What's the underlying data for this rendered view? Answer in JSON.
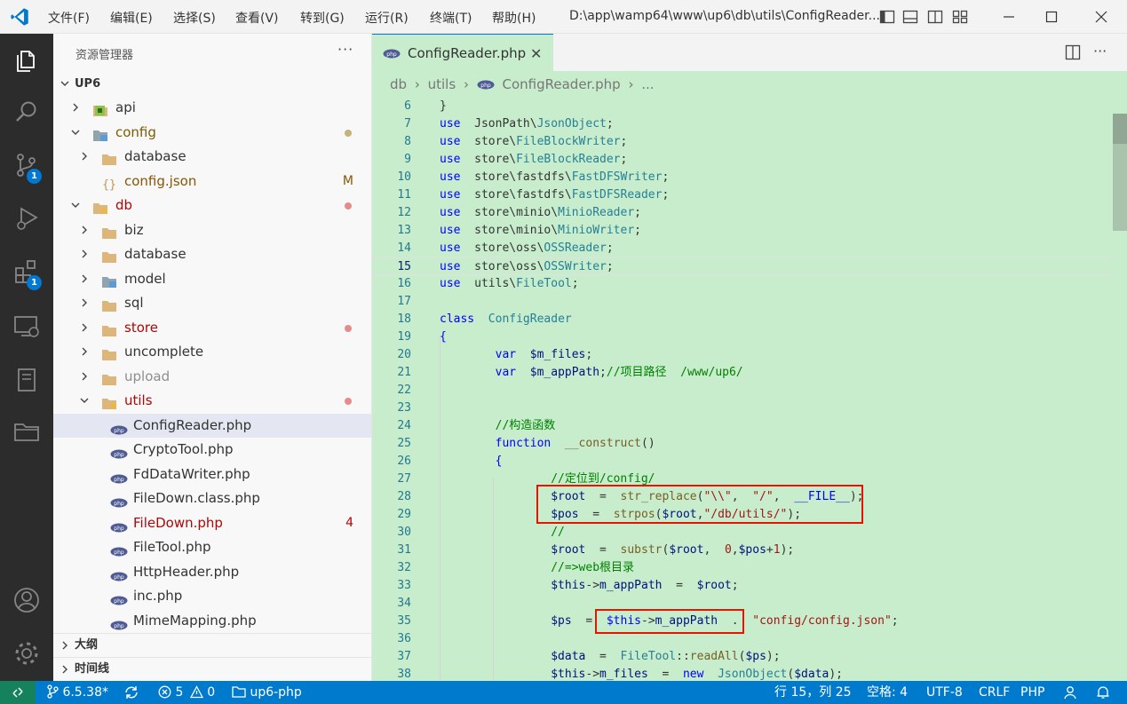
{
  "titlebar": {
    "menus": [
      "文件(F)",
      "编辑(E)",
      "选择(S)",
      "查看(V)",
      "转到(G)",
      "运行(R)",
      "终端(T)",
      "帮助(H)"
    ],
    "path": "D:\\app\\wamp64\\www\\up6\\db\\utils\\ConfigReader...."
  },
  "activitybar": {
    "source_control_badge": "1",
    "extensions_badge": "1"
  },
  "explorer": {
    "title": "资源管理器",
    "more": "···",
    "root": "UP6",
    "items": [
      {
        "label": "api",
        "depth": 1,
        "type": "folder-special",
        "expanded": false,
        "color": "#333333"
      },
      {
        "label": "config",
        "depth": 1,
        "type": "folder-config",
        "expanded": true,
        "color": "#7a5d00",
        "dot": "#c5b37a"
      },
      {
        "label": "database",
        "depth": 2,
        "type": "folder",
        "expanded": false,
        "color": "#333333"
      },
      {
        "label": "config.json",
        "depth": 2,
        "type": "json",
        "color": "#895503",
        "status": "M",
        "status_color": "#895503"
      },
      {
        "label": "db",
        "depth": 1,
        "type": "folder-db",
        "expanded": true,
        "color": "#ad0707",
        "dot": "#e48b8b"
      },
      {
        "label": "biz",
        "depth": 2,
        "type": "folder",
        "expanded": false,
        "color": "#333333"
      },
      {
        "label": "database",
        "depth": 2,
        "type": "folder",
        "expanded": false,
        "color": "#333333"
      },
      {
        "label": "model",
        "depth": 2,
        "type": "folder-model",
        "expanded": false,
        "color": "#333333"
      },
      {
        "label": "sql",
        "depth": 2,
        "type": "folder",
        "expanded": false,
        "color": "#333333"
      },
      {
        "label": "store",
        "depth": 2,
        "type": "folder",
        "expanded": false,
        "color": "#ad0707",
        "dot": "#e48b8b"
      },
      {
        "label": "uncomplete",
        "depth": 2,
        "type": "folder",
        "expanded": false,
        "color": "#333333"
      },
      {
        "label": "upload",
        "depth": 2,
        "type": "folder",
        "expanded": false,
        "color": "#8e8e90"
      },
      {
        "label": "utils",
        "depth": 2,
        "type": "folder-utils",
        "expanded": true,
        "color": "#ad0707",
        "dot": "#e48b8b"
      },
      {
        "label": "ConfigReader.php",
        "depth": 3,
        "type": "php",
        "color": "#333333",
        "selected": true
      },
      {
        "label": "CryptoTool.php",
        "depth": 3,
        "type": "php",
        "color": "#333333"
      },
      {
        "label": "FdDataWriter.php",
        "depth": 3,
        "type": "php",
        "color": "#333333"
      },
      {
        "label": "FileDown.class.php",
        "depth": 3,
        "type": "php",
        "color": "#333333"
      },
      {
        "label": "FileDown.php",
        "depth": 3,
        "type": "php",
        "color": "#ad0707",
        "status": "4",
        "status_color": "#ad0707"
      },
      {
        "label": "FileTool.php",
        "depth": 3,
        "type": "php",
        "color": "#333333"
      },
      {
        "label": "HttpHeader.php",
        "depth": 3,
        "type": "php",
        "color": "#333333"
      },
      {
        "label": "inc.php",
        "depth": 3,
        "type": "php",
        "color": "#333333"
      },
      {
        "label": "MimeMapping.php",
        "depth": 3,
        "type": "php",
        "color": "#333333"
      }
    ],
    "outline": "大纲",
    "timeline": "时间线"
  },
  "editor": {
    "tab_label": "ConfigReader.php",
    "tab_close": "✕",
    "more": "···",
    "breadcrumb": [
      "db",
      "›",
      "utils",
      "›",
      "ConfigReader.php",
      "›",
      "..."
    ],
    "lines": [
      {
        "n": "6",
        "html": "<span>}</span>"
      },
      {
        "n": "7",
        "html": "<span class='k'>use</span>  JsonPath\\<span class='t'>JsonObject</span>;"
      },
      {
        "n": "8",
        "html": "<span class='k'>use</span>  store\\<span class='t'>FileBlockWriter</span>;"
      },
      {
        "n": "9",
        "html": "<span class='k'>use</span>  store\\<span class='t'>FileBlockReader</span>;"
      },
      {
        "n": "10",
        "html": "<span class='k'>use</span>  store\\fastdfs\\<span class='t'>FastDFSWriter</span>;"
      },
      {
        "n": "11",
        "html": "<span class='k'>use</span>  store\\fastdfs\\<span class='t'>FastDFSReader</span>;"
      },
      {
        "n": "12",
        "html": "<span class='k'>use</span>  store\\minio\\<span class='t'>MinioReader</span>;"
      },
      {
        "n": "13",
        "html": "<span class='k'>use</span>  store\\minio\\<span class='t'>MinioWriter</span>;"
      },
      {
        "n": "14",
        "html": "<span class='k'>use</span>  store\\oss\\<span class='t'>OSSReader</span>;"
      },
      {
        "n": "15",
        "html": "<span class='k'>use</span>  store\\oss\\<span class='t'>OSSWriter</span>;",
        "current": true
      },
      {
        "n": "16",
        "html": "<span class='k'>use</span>  utils\\<span class='t'>FileTool</span>;"
      },
      {
        "n": "17",
        "html": ""
      },
      {
        "n": "18",
        "html": "<span class='k'>class</span>  <span class='t'>ConfigReader</span>"
      },
      {
        "n": "19",
        "html": "<span class='k'>{</span>"
      },
      {
        "n": "20",
        "html": "        <span class='k'>var</span>  <span class='v'>$m_files</span>;"
      },
      {
        "n": "21",
        "html": "        <span class='k'>var</span>  <span class='v'>$m_appPath</span>;<span class='c'>//项目路径  /www/up6/</span>"
      },
      {
        "n": "22",
        "html": ""
      },
      {
        "n": "23",
        "html": ""
      },
      {
        "n": "24",
        "html": "        <span class='c'>//构造函数</span>"
      },
      {
        "n": "25",
        "html": "        <span class='k'>function</span>  <span class='f'>__construct</span>()"
      },
      {
        "n": "26",
        "html": "        <span class='k'>{</span>"
      },
      {
        "n": "27",
        "html": "                <span class='c'>//定位到/config/</span>"
      },
      {
        "n": "28",
        "html": "                <span class='v'>$root</span>  =  <span class='f'>str_replace</span>(<span class='s'>\"\\\\\"</span>,  <span class='s'>\"/\"</span>,  <span class='k'>__FILE__</span>);"
      },
      {
        "n": "29",
        "html": "                <span class='v'>$pos</span>  =  <span class='f'>strpos</span>(<span class='v'>$root</span>,<span class='s'>\"/db/utils/\"</span>);"
      },
      {
        "n": "30",
        "html": "                <span class='c'>//</span>"
      },
      {
        "n": "31",
        "html": "                <span class='v'>$root</span>  =  <span class='f'>substr</span>(<span class='v'>$root</span>,  <span class='s'>0</span>,<span class='v'>$pos</span>+<span class='s'>1</span>);"
      },
      {
        "n": "32",
        "html": "                <span class='c'>//=&gt;web根目录</span>"
      },
      {
        "n": "33",
        "html": "                <span class='v'>$this</span>-&gt;<span class='v'>m_appPath</span>  =  <span class='v'>$root</span>;"
      },
      {
        "n": "34",
        "html": ""
      },
      {
        "n": "35",
        "html": "                <span class='v'>$ps</span>  =  <span class='k'>$this</span>-&gt;<span class='v'>m_appPath</span>  .  <span class='s'>\"config/config.json\"</span>;"
      },
      {
        "n": "36",
        "html": ""
      },
      {
        "n": "37",
        "html": "                <span class='v'>$data</span>  =  <span class='t'>FileTool</span>::<span class='f'>readAll</span>(<span class='v'>$ps</span>);"
      },
      {
        "n": "38",
        "html": "                <span class='v'>$this</span>-&gt;<span class='v'>m_files</span>  =  <span class='k'>new</span>  <span class='t'>JsonObject</span>(<span class='v'>$data</span>);"
      }
    ]
  },
  "statusbar": {
    "branch": "6.5.38*",
    "errors": "5",
    "warnings": "0",
    "project": "up6-php",
    "position": "行 15，列 25",
    "spaces": "空格: 4",
    "encoding": "UTF-8",
    "eol": "CRLF",
    "language": "PHP"
  },
  "colors": {
    "accent": "#007acc",
    "editor_bg": "#c7edcc",
    "highlight_box": "#e51400"
  }
}
